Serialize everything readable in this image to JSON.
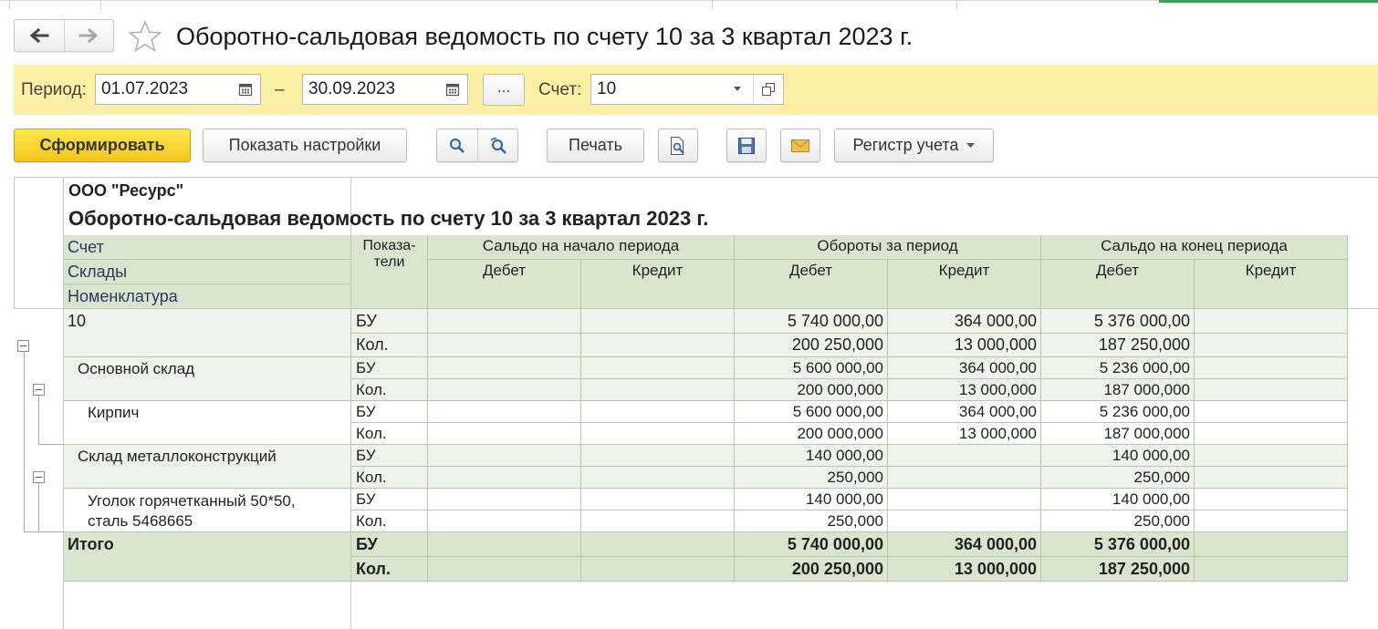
{
  "window": {
    "title": "Оборотно-сальдовая ведомость по счету 10 за 3 квартал 2023 г."
  },
  "params": {
    "period_label": "Период:",
    "date_from": "01.07.2023",
    "dash": "–",
    "date_to": "30.09.2023",
    "more_label": "...",
    "account_label": "Счет:",
    "account_value": "10"
  },
  "toolbar": {
    "generate": "Сформировать",
    "show_settings": "Показать настройки",
    "print": "Печать",
    "register": "Регистр учета"
  },
  "icons": {
    "back": "arrow-left-icon",
    "forward": "arrow-right-icon",
    "favorite": "star-icon",
    "calendar": "calendar-icon",
    "dropdown": "chevron-down-icon",
    "open": "open-window-icon",
    "search": "search-icon",
    "search_reset": "search-reset-icon",
    "preview": "print-preview-icon",
    "save": "floppy-disk-icon",
    "mail": "envelope-icon"
  },
  "colors": {
    "panel": "#fbefa3",
    "primary_button": "#f5cf2a",
    "header_bg": "#d9e6cf",
    "row_light": "#eef4e9"
  },
  "report": {
    "org": "ООО \"Ресурс\"",
    "title": "Оборотно-сальдовая ведомость по счету 10 за 3 квартал 2023 г.",
    "headers": {
      "account": "Счет",
      "warehouse": "Склады",
      "nomenclature": "Номенклатура",
      "indicator": "Показа-\nтели",
      "opening": "Сальдо на начало периода",
      "turnover": "Обороты за период",
      "closing": "Сальдо на конец периода",
      "debit": "Дебет",
      "credit": "Кредит"
    },
    "groups": [
      {
        "name": "10",
        "rows": [
          {
            "ind": "БУ",
            "ob_d": "5 740 000,00",
            "ob_c": "364 000,00",
            "end_d": "5 376 000,00"
          },
          {
            "ind": "Кол.",
            "ob_d": "200 250,000",
            "ob_c": "13 000,000",
            "end_d": "187 250,000"
          }
        ]
      },
      {
        "name": "Основной склад",
        "rows": [
          {
            "ind": "БУ",
            "ob_d": "5 600 000,00",
            "ob_c": "364 000,00",
            "end_d": "5 236 000,00"
          },
          {
            "ind": "Кол.",
            "ob_d": "200 000,000",
            "ob_c": "13 000,000",
            "end_d": "187 000,000"
          }
        ]
      },
      {
        "name": "Кирпич",
        "rows": [
          {
            "ind": "БУ",
            "ob_d": "5 600 000,00",
            "ob_c": "364 000,00",
            "end_d": "5 236 000,00"
          },
          {
            "ind": "Кол.",
            "ob_d": "200 000,000",
            "ob_c": "13 000,000",
            "end_d": "187 000,000"
          }
        ]
      },
      {
        "name": "Склад металлоконструкций",
        "rows": [
          {
            "ind": "БУ",
            "ob_d": "140 000,00",
            "ob_c": "",
            "end_d": "140 000,00"
          },
          {
            "ind": "Кол.",
            "ob_d": "250,000",
            "ob_c": "",
            "end_d": "250,000"
          }
        ]
      },
      {
        "name": "Уголок горячетканный 50*50,\nсталь 5468665",
        "rows": [
          {
            "ind": "БУ",
            "ob_d": "140 000,00",
            "ob_c": "",
            "end_d": "140 000,00"
          },
          {
            "ind": "Кол.",
            "ob_d": "250,000",
            "ob_c": "",
            "end_d": "250,000"
          }
        ]
      },
      {
        "name": "Итого",
        "rows": [
          {
            "ind": "БУ",
            "ob_d": "5 740 000,00",
            "ob_c": "364 000,00",
            "end_d": "5 376 000,00"
          },
          {
            "ind": "Кол.",
            "ob_d": "200 250,000",
            "ob_c": "13 000,000",
            "end_d": "187 250,000"
          }
        ]
      }
    ]
  }
}
